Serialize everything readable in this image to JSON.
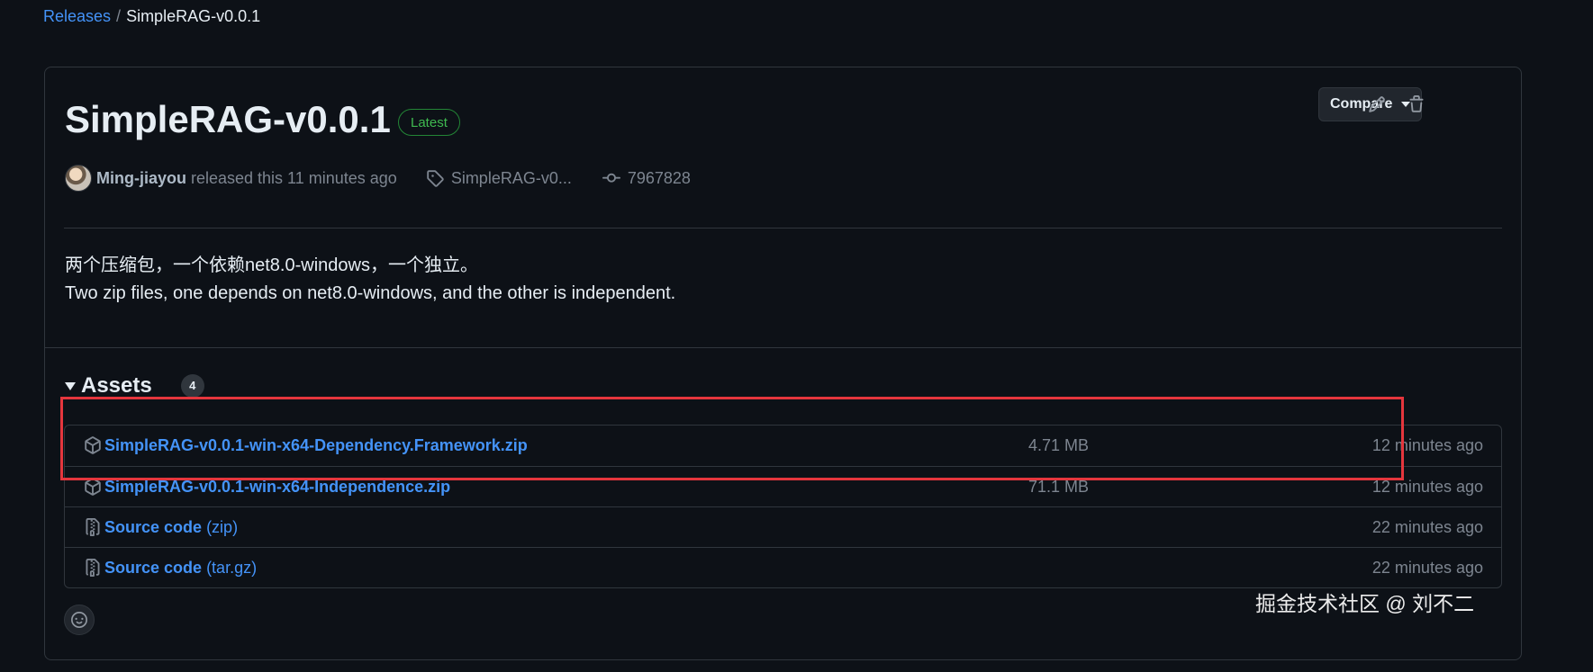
{
  "breadcrumb": {
    "parent": "Releases",
    "separator": "/",
    "current": "SimpleRAG-v0.0.1"
  },
  "release": {
    "title": "SimpleRAG-v0.0.1",
    "badge": "Latest",
    "compare_label": "Compare",
    "author": "Ming-jiayou",
    "released_text": "released this 11 minutes ago",
    "tag": "SimpleRAG-v0...",
    "commit": "7967828",
    "notes": [
      "两个压缩包，一个依赖net8.0-windows，一个独立。",
      "Two zip files, one depends on net8.0-windows, and the other is independent."
    ]
  },
  "assets": {
    "heading": "Assets",
    "count": "4",
    "items": [
      {
        "name": "SimpleRAG-v0.0.1-win-x64-Dependency.Framework.zip",
        "ext": "",
        "size": "4.71 MB",
        "time": "12 minutes ago",
        "icon": "package-icon"
      },
      {
        "name": "SimpleRAG-v0.0.1-win-x64-Independence.zip",
        "ext": "",
        "size": "71.1 MB",
        "time": "12 minutes ago",
        "icon": "package-icon"
      },
      {
        "name": "Source code",
        "ext": "(zip)",
        "size": "",
        "time": "22 minutes ago",
        "icon": "file-zip-icon"
      },
      {
        "name": "Source code",
        "ext": "(tar.gz)",
        "size": "",
        "time": "22 minutes ago",
        "icon": "file-zip-icon"
      }
    ]
  },
  "watermark": "掘金技术社区 @ 刘不二",
  "colors": {
    "background": "#0d1117",
    "link": "#4493f8",
    "latest_badge": "#3fb950",
    "highlight": "#e5363d"
  }
}
